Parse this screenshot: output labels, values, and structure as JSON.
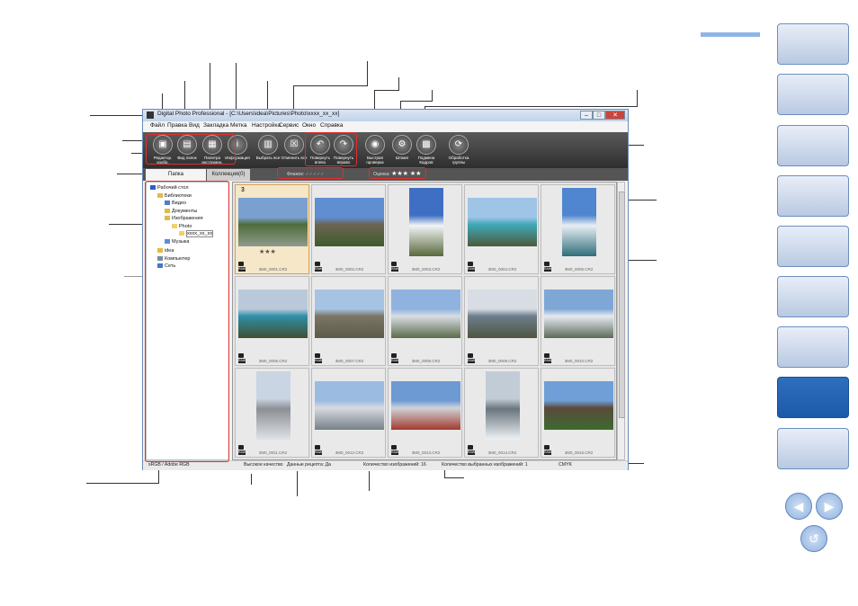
{
  "window": {
    "title": "Digital Photo Professional - [C:\\Users\\idea\\Pictures\\Photo\\xxxx_xx_xx]",
    "controls": {
      "minimize": "–",
      "maximize": "□",
      "close": "✕"
    }
  },
  "menu": [
    "Файл",
    "Правка",
    "Вид",
    "Закладка",
    "Метка",
    "Настройка",
    "Сервис",
    "Окно",
    "Справка"
  ],
  "toolbar": [
    {
      "label": "Редактор. изобр.",
      "icon": "edit-image-icon"
    },
    {
      "label": "Вид папок",
      "icon": "folder-view-icon"
    },
    {
      "label": "Палитра инструмен.",
      "icon": "tool-palette-icon"
    },
    {
      "label": "Информация",
      "icon": "info-icon"
    },
    {
      "label": "Выбрать все",
      "icon": "select-all-icon"
    },
    {
      "label": "Отменить все",
      "icon": "deselect-all-icon"
    },
    {
      "label": "Повернуть влево",
      "icon": "rotate-left-icon"
    },
    {
      "label": "Повернуть вправо",
      "icon": "rotate-right-icon"
    },
    {
      "label": "Быстрая проверка",
      "icon": "quick-check-icon"
    },
    {
      "label": "Штамп",
      "icon": "stamp-icon"
    },
    {
      "label": "Подмена Кадров",
      "icon": "trim-icon"
    },
    {
      "label": "Обработка группы",
      "icon": "batch-icon"
    }
  ],
  "tabs": {
    "folder": "Папка",
    "collection": "Коллекция(0)"
  },
  "filter": {
    "label": "Флажок:",
    "checks": "✓✓✓✓✓",
    "rating_label": "Оценка:",
    "rating_stars": "★★★ ★★"
  },
  "tree": [
    {
      "label": "Рабочий стол",
      "level": 0,
      "color": "#2c5fbf"
    },
    {
      "label": "Библиотеки",
      "level": 1,
      "color": "#e3b94a"
    },
    {
      "label": "Видео",
      "level": 2,
      "color": "#4a7dd0"
    },
    {
      "label": "Документы",
      "level": 2,
      "color": "#e3b94a"
    },
    {
      "label": "Изображения",
      "level": 2,
      "color": "#e3b94a"
    },
    {
      "label": "Photo",
      "level": 3,
      "color": "#f2d06b"
    },
    {
      "label": "xxxx_xx_xx",
      "level": 4,
      "color": "#f2d06b"
    },
    {
      "label": "Музыка",
      "level": 2,
      "color": "#5a8fd6"
    },
    {
      "label": "idea",
      "level": 1,
      "color": "#e3b94a"
    },
    {
      "label": "Компьютер",
      "level": 1,
      "color": "#7a8aa0"
    },
    {
      "label": "Сеть",
      "level": 1,
      "color": "#3d7cc9"
    }
  ],
  "thumbnails": [
    {
      "name": "3M0_0001.CR2",
      "stars": "★★★",
      "mark": "3",
      "selected": true,
      "colors": [
        "#7aa0d2",
        "#4f6d3a",
        "#8e9a8c"
      ],
      "portrait": false
    },
    {
      "name": "3M0_0002.CR2",
      "colors": [
        "#5f8ed1",
        "#6b6552",
        "#3f5b2c"
      ],
      "portrait": false
    },
    {
      "name": "3M0_0003.CR2",
      "colors": [
        "#3f6fc2",
        "#f2f4f7",
        "#5a6a3c"
      ],
      "portrait": true
    },
    {
      "name": "3M0_0004.CR2",
      "colors": [
        "#9ec4e6",
        "#3fa9b8",
        "#4b5a3a"
      ],
      "portrait": false
    },
    {
      "name": "3M0_0005.CR2",
      "colors": [
        "#4f86cf",
        "#e9eef5",
        "#2f6e7a"
      ],
      "portrait": true
    },
    {
      "name": "3M0_0006.CR2",
      "colors": [
        "#b9c9d9",
        "#2f8fa8",
        "#3e4f31"
      ],
      "portrait": false
    },
    {
      "name": "3M0_0007.CR2",
      "colors": [
        "#a7c3e3",
        "#7a7564",
        "#5b5b4c"
      ],
      "portrait": false
    },
    {
      "name": "3M0_0008.CR2",
      "colors": [
        "#8fb3de",
        "#d9dde3",
        "#5b6b4a"
      ],
      "portrait": false
    },
    {
      "name": "3M0_0009.CR2",
      "colors": [
        "#d8dde4",
        "#6d7d8c",
        "#4e5540"
      ],
      "portrait": false
    },
    {
      "name": "3M0_0010.CR2",
      "colors": [
        "#7fa7d6",
        "#e6eaf0",
        "#5d6a59"
      ],
      "portrait": false
    },
    {
      "name": "3M0_0011.CR2",
      "colors": [
        "#c9d5e2",
        "#8c8f94",
        "#dfe3e8"
      ],
      "portrait": true
    },
    {
      "name": "3M0_0012.CR2",
      "colors": [
        "#9bbbe0",
        "#d7dbe0",
        "#777f88"
      ],
      "portrait": false
    },
    {
      "name": "3M0_0013.CR2",
      "colors": [
        "#6e9ad3",
        "#cfd3d8",
        "#a33a2f"
      ],
      "portrait": false
    },
    {
      "name": "3M0_0014.CR2",
      "colors": [
        "#c2ccd6",
        "#69757d",
        "#eef2f5"
      ],
      "portrait": true
    },
    {
      "name": "3M0_0015.CR2",
      "colors": [
        "#6f9fd6",
        "#5a4a3c",
        "#3d6a2f"
      ],
      "portrait": false
    }
  ],
  "status": {
    "profile": "sRGB / Adobe RGB",
    "quality": "Высокое качество",
    "recipe": "Данные рецепта: Да",
    "count": "Количество изображений: 16",
    "selected": "Количество выбранных изображений: 1",
    "cmyk": "CMYK"
  },
  "nav": {
    "prev": "◀",
    "next": "▶",
    "back": "↺"
  }
}
